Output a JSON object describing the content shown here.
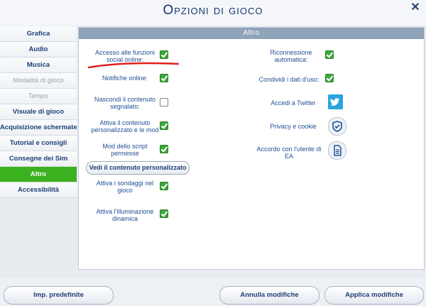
{
  "window": {
    "title": "Opzioni di gioco",
    "close_icon": "close-icon"
  },
  "sidebar": {
    "items": [
      {
        "label": "Grafica",
        "state": "normal"
      },
      {
        "label": "Audio",
        "state": "normal"
      },
      {
        "label": "Musica",
        "state": "normal"
      },
      {
        "label": "Modalità di gioco",
        "state": "disabled"
      },
      {
        "label": "Tempo",
        "state": "disabled"
      },
      {
        "label": "Visuale di gioco",
        "state": "normal"
      },
      {
        "label": "Acquisizione schermate",
        "state": "normal"
      },
      {
        "label": "Tutorial e consigli",
        "state": "normal"
      },
      {
        "label": "Consegne dei Sim",
        "state": "normal"
      },
      {
        "label": "Altro",
        "state": "active"
      },
      {
        "label": "Accessibilità",
        "state": "normal"
      }
    ]
  },
  "panel": {
    "header": "Altro",
    "left_options": [
      {
        "label_line1": "Accesso alle funzioni",
        "label_line2": "social online:",
        "checked": true
      },
      {
        "label_line1": "Notifiche online:",
        "label_line2": "",
        "checked": true
      },
      {
        "label_line1": "Nascondi il contenuto",
        "label_line2": "segnalato:",
        "checked": false
      },
      {
        "label_line1": "Attiva il contenuto",
        "label_line2": "personalizzato e le mod",
        "checked": true
      },
      {
        "label_line1": "Mod dello script",
        "label_line2": "permesse",
        "checked": true
      },
      {
        "label_line1": "Attiva i sondaggi nel",
        "label_line2": "gioco",
        "checked": true
      },
      {
        "label_line1": "Attiva l'illuminazione",
        "label_line2": "dinamica",
        "checked": true
      }
    ],
    "custom_content_button": "Vedi il contenuto personalizzato",
    "right_options": [
      {
        "label_line1": "Riconnessione",
        "label_line2": "automatica:",
        "checked": true
      },
      {
        "label_line1": "Condividi i dati d'uso:",
        "label_line2": "",
        "checked": true
      }
    ],
    "links": [
      {
        "label_line1": "Accedi a Twitter",
        "label_line2": "",
        "icon": "twitter-icon"
      },
      {
        "label_line1": "Privacy e cookie",
        "label_line2": "",
        "icon": "shield-check-icon"
      },
      {
        "label_line1": "Accordo con l'utente di",
        "label_line2": "EA",
        "icon": "document-icon"
      }
    ]
  },
  "footer": {
    "defaults_button": "Imp. predefinite",
    "cancel_button": "Annulla modifiche",
    "apply_button": "Applica modifiche"
  },
  "colors": {
    "accent_green": "#3cb11f",
    "title_blue": "#15356c",
    "panel_header": "#8fa3b9",
    "annotation_red": "#e02020"
  }
}
